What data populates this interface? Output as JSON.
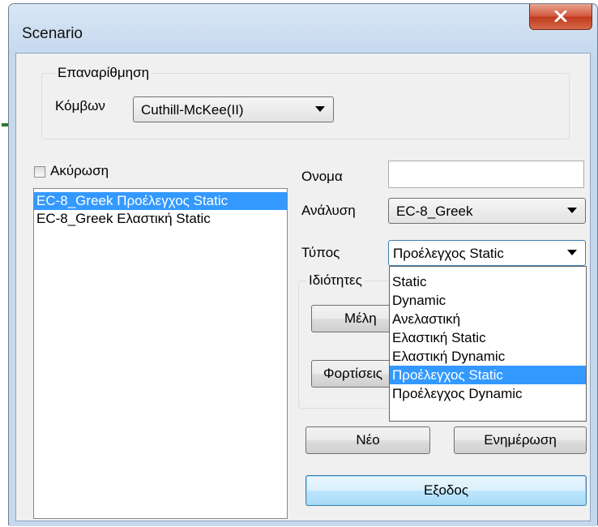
{
  "window": {
    "title": "Scenario",
    "close_label": "x"
  },
  "renumbering": {
    "group_label": "Επαναρίθμηση",
    "nodes_label": "Κόμβων",
    "method_value": "Cuthill-McKee(II)"
  },
  "cancel_checkbox": {
    "label": "Ακύρωση",
    "checked": false
  },
  "scenario_list": {
    "items": [
      {
        "label": "EC-8_Greek Προέλεγχος Static",
        "selected": true
      },
      {
        "label": "EC-8_Greek Ελαστική Static",
        "selected": false
      }
    ]
  },
  "form": {
    "name_label": "Ονομα",
    "name_value": "",
    "analysis_label": "Ανάλυση",
    "analysis_value": "EC-8_Greek",
    "type_label": "Τύπος",
    "type_value": "Προέλεγχος Static"
  },
  "properties": {
    "group_label": "Ιδιότητες",
    "members_button": "Μέλη",
    "loads_button": "Φορτίσεις"
  },
  "type_dropdown": {
    "options": [
      {
        "label": "Static",
        "selected": false
      },
      {
        "label": "Dynamic",
        "selected": false
      },
      {
        "label": "Ανελαστική",
        "selected": false
      },
      {
        "label": "Ελαστική Static",
        "selected": false
      },
      {
        "label": "Ελαστική Dynamic",
        "selected": false
      },
      {
        "label": "Προέλεγχος Static",
        "selected": true
      },
      {
        "label": "Προέλεγχος Dynamic",
        "selected": false
      }
    ]
  },
  "actions": {
    "new_button": "Νέο",
    "update_button": "Ενημέρωση",
    "exit_button": "Εξοδος"
  },
  "colors": {
    "selection": "#3399ff",
    "close_button": "#c7442a",
    "title_bar": "#c6d9ee"
  }
}
